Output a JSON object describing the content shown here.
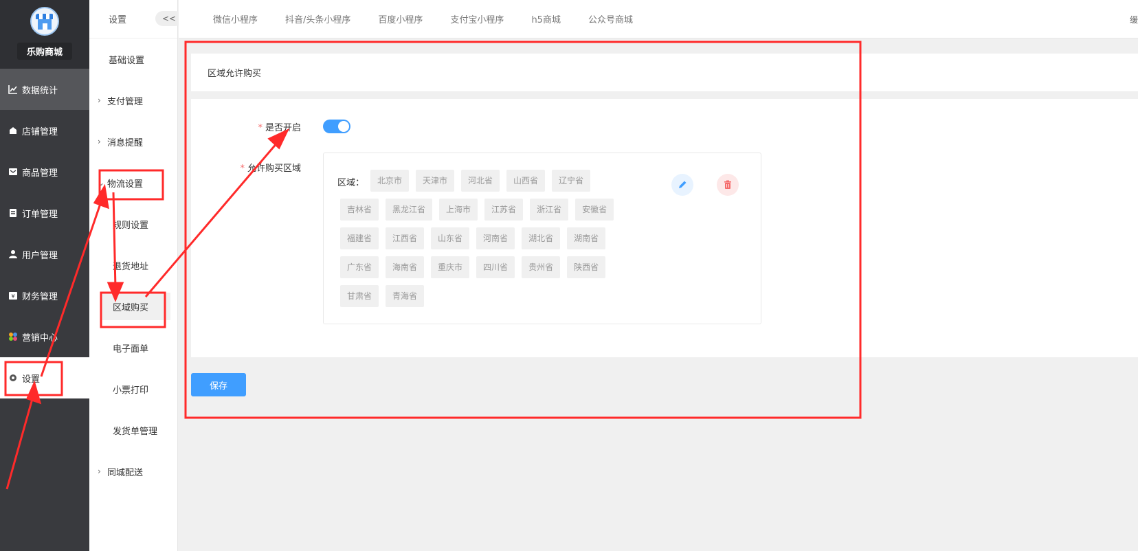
{
  "brand": {
    "name": "乐购商城"
  },
  "sidebar": {
    "items": [
      {
        "label": "数据统计",
        "icon": "chart-icon"
      },
      {
        "label": "店铺管理",
        "icon": "store-icon"
      },
      {
        "label": "商品管理",
        "icon": "goods-icon"
      },
      {
        "label": "订单管理",
        "icon": "order-icon"
      },
      {
        "label": "用户管理",
        "icon": "user-icon"
      },
      {
        "label": "财务管理",
        "icon": "finance-icon"
      },
      {
        "label": "营销中心",
        "icon": "marketing-icon"
      },
      {
        "label": "设置",
        "icon": "gear-icon"
      }
    ]
  },
  "subbar": {
    "title": "设置",
    "collapse": "<<",
    "items": [
      {
        "label": "基础设置"
      },
      {
        "label": "支付管理"
      },
      {
        "label": "消息提醒"
      },
      {
        "label": "物流设置"
      },
      {
        "label": "规则设置"
      },
      {
        "label": "退货地址"
      },
      {
        "label": "区域购买"
      },
      {
        "label": "电子面单"
      },
      {
        "label": "小票打印"
      },
      {
        "label": "发货单管理"
      },
      {
        "label": "同城配送"
      }
    ]
  },
  "topbar": {
    "tabs": [
      "微信小程序",
      "抖音/头条小程序",
      "百度小程序",
      "支付宝小程序",
      "h5商城",
      "公众号商城"
    ],
    "right_text": "缓"
  },
  "main": {
    "card_title": "区域允许购买",
    "enable_label": "是否开启",
    "enabled": true,
    "region_label": "允许购买区域",
    "region_prefix": "区域：",
    "regions": [
      [
        "北京市",
        "天津市",
        "河北省",
        "山西省",
        "辽宁省"
      ],
      [
        "吉林省",
        "黑龙江省",
        "上海市",
        "江苏省",
        "浙江省",
        "安徽省"
      ],
      [
        "福建省",
        "江西省",
        "山东省",
        "河南省",
        "湖北省",
        "湖南省"
      ],
      [
        "广东省",
        "海南省",
        "重庆市",
        "四川省",
        "贵州省",
        "陕西省"
      ],
      [
        "甘肃省",
        "青海省"
      ]
    ],
    "save_label": "保存"
  },
  "colors": {
    "primary": "#409eff",
    "annotation": "#ff2a2a",
    "sidebar": "#393a3e"
  }
}
